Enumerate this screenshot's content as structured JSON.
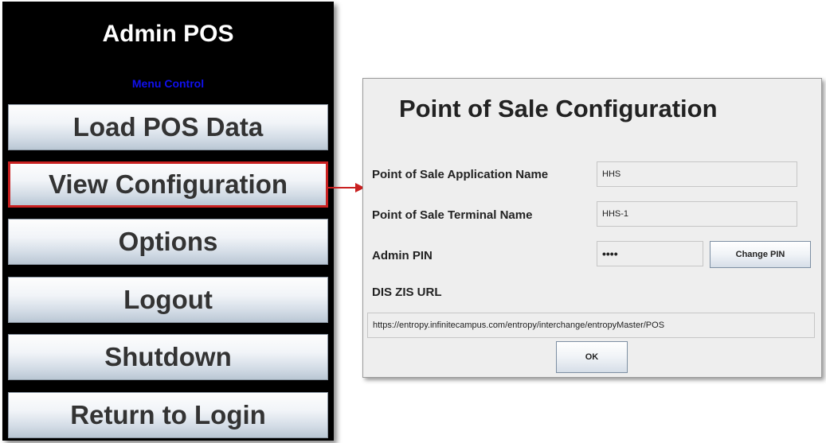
{
  "admin": {
    "title": "Admin POS",
    "subtitle": "Menu Control",
    "menu": [
      {
        "label": "Load POS Data"
      },
      {
        "label": "View Configuration"
      },
      {
        "label": "Options"
      },
      {
        "label": "Logout"
      },
      {
        "label": "Shutdown"
      },
      {
        "label": "Return to Login"
      }
    ],
    "selected_item": "View Configuration"
  },
  "config": {
    "title": "Point of Sale Configuration",
    "app_name_label": "Point of Sale Application Name",
    "app_name_value": "HHS",
    "terminal_name_label": "Point of Sale Terminal Name",
    "terminal_name_value": "HHS-1",
    "admin_pin_label": "Admin PIN",
    "admin_pin_value": "••••",
    "change_pin_button": "Change PIN",
    "url_label": "DIS ZIS URL",
    "url_value": "https://entropy.infinitecampus.com/entropy/interchange/entropyMaster/POS",
    "ok_button": "OK"
  },
  "colors": {
    "panel_background": "#000000",
    "subtitle_color": "#1010ee",
    "selection_highlight": "#c92020",
    "dialog_background": "#eeeeee"
  }
}
